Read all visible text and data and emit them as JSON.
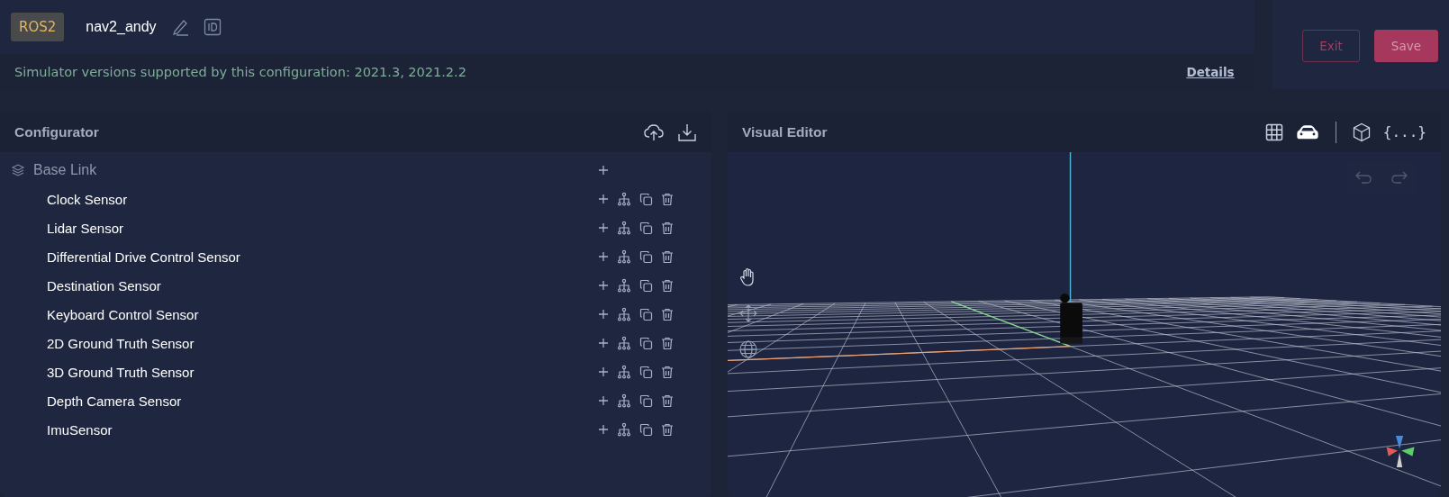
{
  "header": {
    "tag": "ROS2",
    "name": "nav2_andy",
    "version_notice": "Simulator versions supported by this configuration: 2021.3, 2021.2.2",
    "details_link": "Details"
  },
  "actions": [
    {
      "label": "Exit",
      "kind": "outline"
    },
    {
      "label": "Save",
      "kind": "filled"
    }
  ],
  "configurator": {
    "title": "Configurator",
    "root": {
      "label": "Base Link",
      "children": [
        {
          "label": "Clock Sensor"
        },
        {
          "label": "Lidar Sensor"
        },
        {
          "label": "Differential Drive Control Sensor"
        },
        {
          "label": "Destination Sensor"
        },
        {
          "label": "Keyboard Control Sensor"
        },
        {
          "label": "2D Ground Truth Sensor"
        },
        {
          "label": "3D Ground Truth Sensor"
        },
        {
          "label": "Depth Camera Sensor"
        },
        {
          "label": "ImuSensor"
        }
      ]
    }
  },
  "visual_editor": {
    "title": "Visual Editor",
    "view_toggles": [
      {
        "kind": "grid",
        "selected": false
      },
      {
        "kind": "car",
        "selected": true
      }
    ],
    "json_icon": "{...}"
  }
}
